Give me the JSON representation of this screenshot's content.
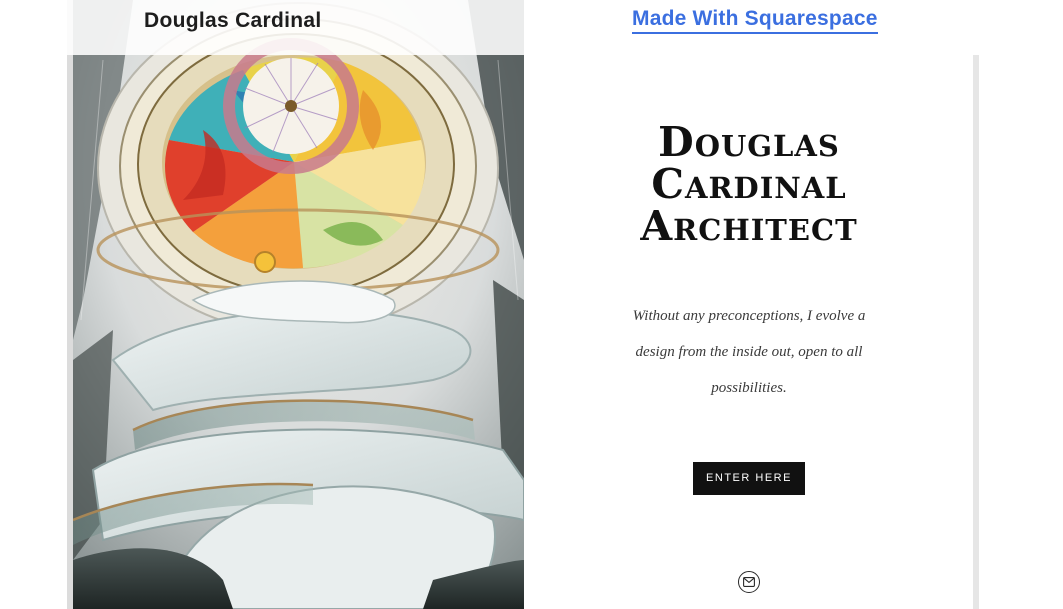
{
  "banner": {
    "site_name": "Douglas Cardinal",
    "made_with_label": "Made With Squarespace"
  },
  "hero": {
    "image_icon": "atrium-photo"
  },
  "main": {
    "title_lines": [
      "Douglas",
      "Cardinal",
      "Architect"
    ],
    "tagline": "Without any preconceptions, I evolve a design from the inside out, open to all possibilities.",
    "enter_button_label": "ENTER HERE",
    "email_icon": "envelope-icon"
  },
  "colors": {
    "link_blue": "#3b6fe0",
    "button_bg": "#111111",
    "title_text": "#111111"
  }
}
